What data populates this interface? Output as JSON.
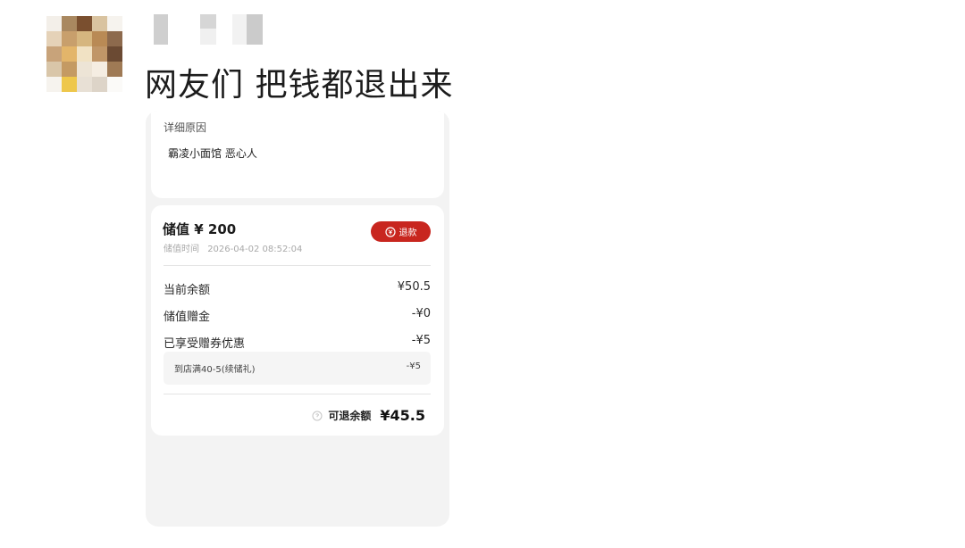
{
  "post": {
    "caption": "网友们  把钱都退出来"
  },
  "reason": {
    "title": "详细原因",
    "value": "霸凌小面馆 恶心人"
  },
  "stored_value": {
    "title": "储值 ¥ 200",
    "time_label": "储值时间",
    "time_value": "2026-04-02 08:52:04",
    "refund_button": "退款"
  },
  "breakdown": {
    "current_balance_label": "当前余额",
    "current_balance_value": "¥50.5",
    "bonus_label": "储值赠金",
    "bonus_value": "-¥0",
    "coupon_label": "已享受赠券优惠",
    "coupon_value": "-¥5",
    "coupon_item_label": "到店满40-5(续储礼)",
    "coupon_item_value": "-¥5"
  },
  "total": {
    "label": "可退余额",
    "value": "¥45.5"
  },
  "colors": {
    "refund_button": "#c8261f"
  }
}
